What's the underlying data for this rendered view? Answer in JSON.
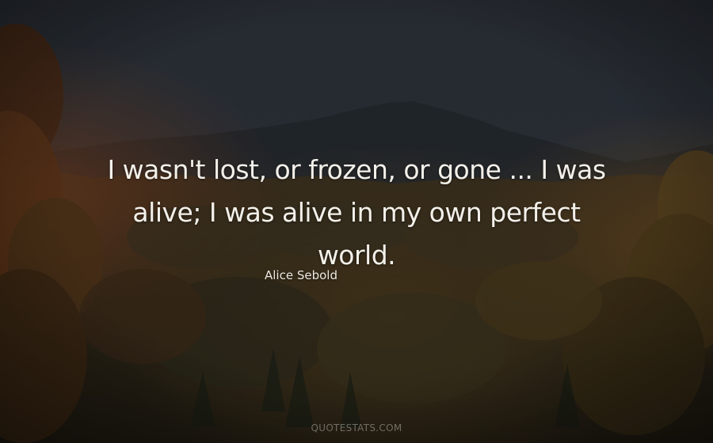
{
  "quote": {
    "line1": "I wasn't lost, or frozen, or gone ... I was",
    "line2": "alive; I was alive in my own perfect world."
  },
  "author": "Alice Sebold",
  "watermark": "QUOTESTATS.COM",
  "colors": {
    "sky": "#2a3038",
    "mountain": "#23282e",
    "foliage_dark": "#2a2518",
    "foliage_warm": "#5a3c1c",
    "text": "#f3f0ea"
  }
}
